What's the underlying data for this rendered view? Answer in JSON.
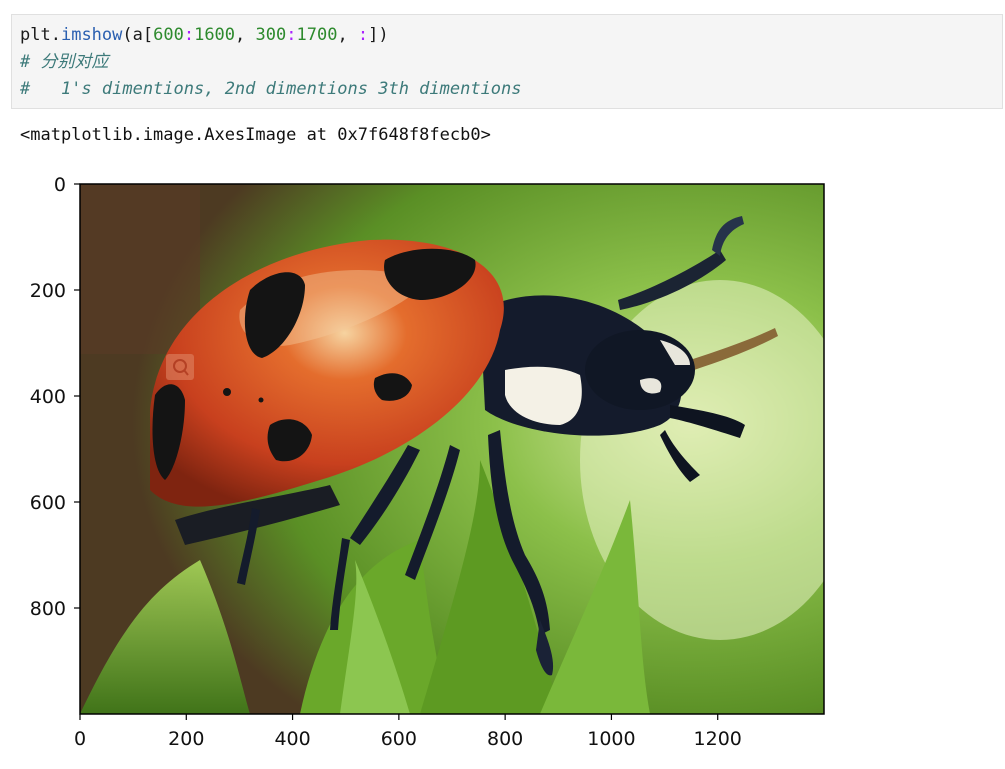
{
  "cell": {
    "line1": {
      "obj": "plt",
      "dot": ".",
      "func": "imshow",
      "open": "(a[",
      "n1": "600",
      "c1": ":",
      "n2": "1600",
      "sep": ", ",
      "n3": "300",
      "c2": ":",
      "n4": "1700",
      "sep2": ", ",
      "c3": ":",
      "close": "])"
    },
    "line2": "# 分别对应",
    "line3": "#   1's dimentions, 2nd dimentions 3th dimentions"
  },
  "output": {
    "text": "<matplotlib.image.AxesImage at 0x7f648f8fecb0>"
  },
  "chart_data": {
    "type": "image",
    "subject": "ladybug on green leaf",
    "xlim": [
      0,
      1400
    ],
    "ylim": [
      1000,
      0
    ],
    "xticks": [
      "0",
      "200",
      "400",
      "600",
      "800",
      "1000",
      "1200"
    ],
    "yticks": [
      "0",
      "200",
      "400",
      "600",
      "800"
    ],
    "colors": {
      "shell": "#c8401e",
      "spots": "#111111",
      "leaf": "#6aa82a",
      "background": "#7ab840"
    }
  }
}
